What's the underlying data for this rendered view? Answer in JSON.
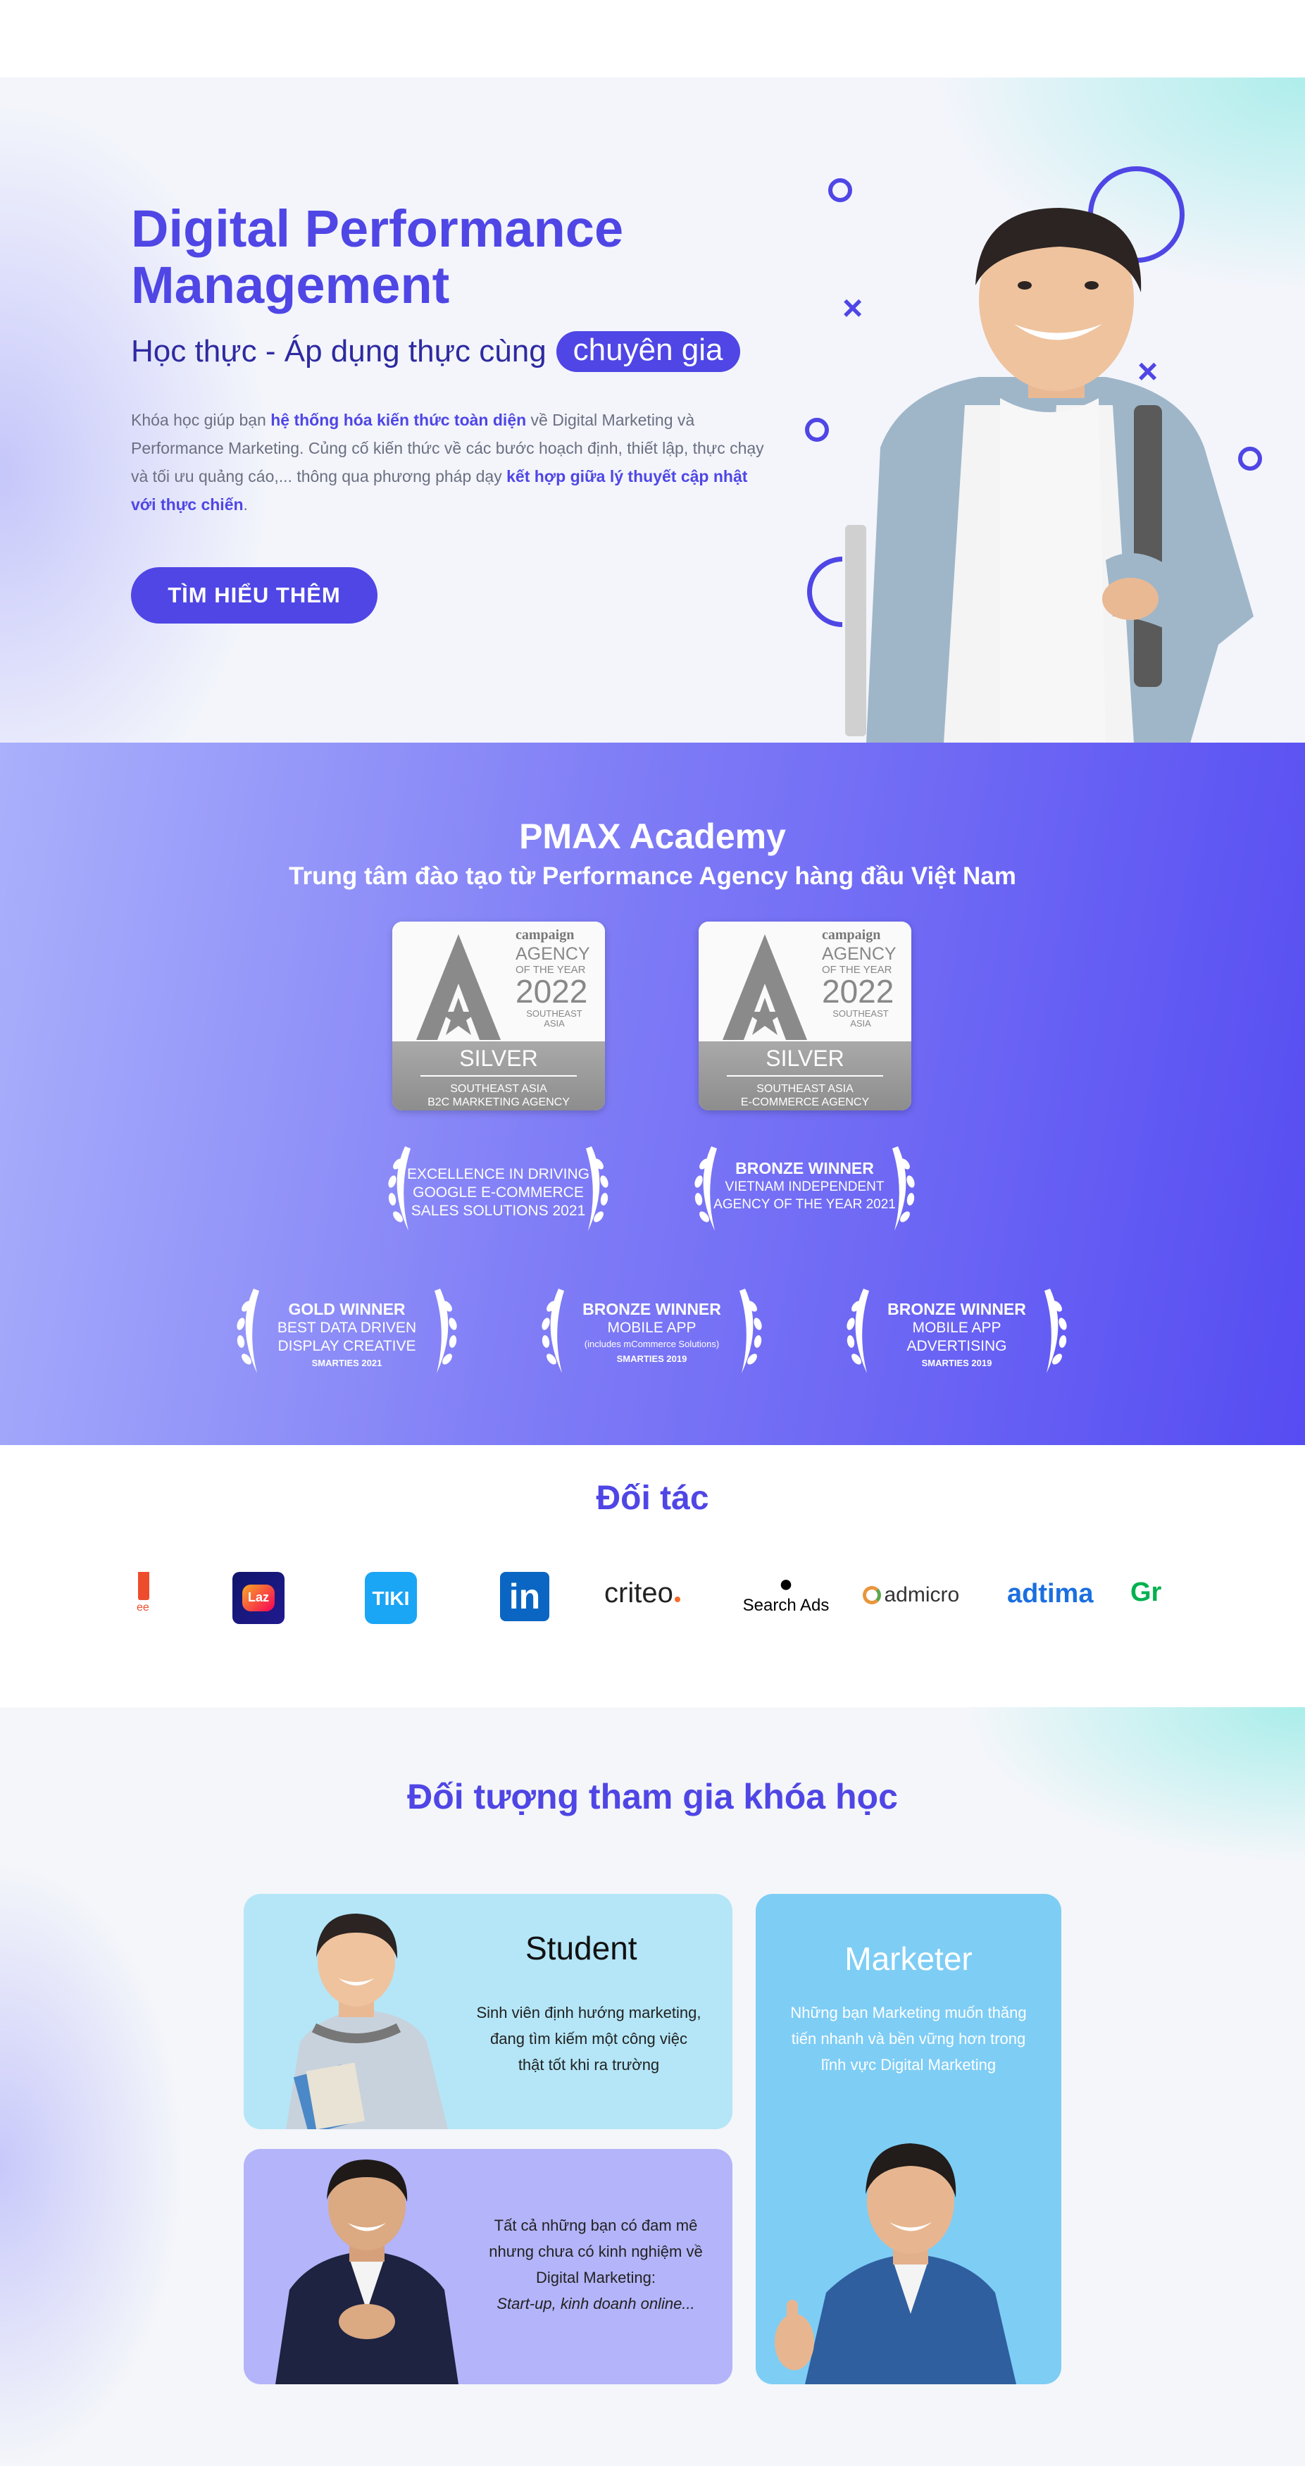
{
  "hero": {
    "title_line1": "Digital Performance",
    "title_line2": "Management",
    "subtitle": "Học thực - Áp dụng thực cùng",
    "subtitle_chip": "chuyên gia",
    "desc_1": "Khóa học giúp bạn ",
    "desc_bold_1": "hệ thống hóa kiến thức toàn diện",
    "desc_2": " về Digital Marketing và Performance Marketing. Củng cố kiến thức về các bước hoạch định, thiết lập, thực chạy và tối ưu quảng cáo,... thông qua phương pháp dạy ",
    "desc_bold_2": "kết hợp giữa lý thuyết cập nhật với thực chiến",
    "desc_3": ".",
    "cta": "TÌM HIỂU THÊM"
  },
  "awards": {
    "title": "PMAX Academy",
    "subtitle": "Trung tâm đào tạo từ Performance Agency hàng đầu Việt Nam",
    "badges": [
      {
        "brand": "campaign",
        "agency": "AGENCY",
        "oty": "OF THE YEAR",
        "year": "2022",
        "region": "SOUTHEAST ASIA",
        "level": "SILVER",
        "cat1": "SOUTHEAST ASIA",
        "cat2": "B2C MARKETING AGENCY"
      },
      {
        "brand": "campaign",
        "agency": "AGENCY",
        "oty": "OF THE YEAR",
        "year": "2022",
        "region": "SOUTHEAST ASIA",
        "level": "SILVER",
        "cat1": "SOUTHEAST ASIA",
        "cat2": "E-COMMERCE AGENCY"
      }
    ],
    "laurels": [
      {
        "l1": "EXCELLENCE IN DRIVING",
        "l2": "GOOGLE E-COMMERCE",
        "l3": "SALES SOLUTIONS 2021"
      },
      {
        "head": "BRONZE WINNER",
        "l1": "VIETNAM INDEPENDENT",
        "l2": "AGENCY OF THE YEAR 2021"
      },
      {
        "head": "GOLD WINNER",
        "l1": "BEST DATA DRIVEN",
        "l2": "DISPLAY CREATIVE",
        "foot": "SMARTIES 2021"
      },
      {
        "head": "BRONZE WINNER",
        "l1": "MOBILE APP",
        "small": "(includes mCommerce Solutions)",
        "foot": "SMARTIES 2019"
      },
      {
        "head": "BRONZE WINNER",
        "l1": "MOBILE APP",
        "l2": "ADVERTISING",
        "foot": "SMARTIES 2019"
      }
    ]
  },
  "partners": {
    "title": "Đối tác",
    "logos": {
      "shopee_partial": "ee",
      "lazada": "Laz",
      "tiki": "TIKI",
      "linkedin": "in",
      "criteo": "criteo",
      "searchads": "Search Ads",
      "admicro": "admicro",
      "adtima": "adtima",
      "grab_partial": "Gr"
    }
  },
  "target": {
    "title": "Đối tượng tham gia khóa học",
    "student": {
      "title": "Student",
      "l1": "Sinh viên định hướng marketing,",
      "l2": "đang tìm kiếm một công việc",
      "l3": "thật tốt khi ra trường"
    },
    "starter": {
      "l1": "Tất cả những bạn có đam mê",
      "l2": "nhưng chưa có kinh nghiệm về",
      "l3": "Digital Marketing:",
      "l4": "Start-up, kinh doanh online..."
    },
    "marketer": {
      "title": "Marketer",
      "l1": "Những bạn Marketing muốn thăng",
      "l2": "tiến nhanh và bền vững hơn trong",
      "l3": "lĩnh vực Digital Marketing"
    }
  },
  "colors": {
    "primary": "#4f46e5",
    "primary_dark": "#2e2aa0",
    "student_card": "#b4e6f7",
    "starter_card": "#b4b4fa",
    "marketer_card": "#7ecdf5"
  }
}
